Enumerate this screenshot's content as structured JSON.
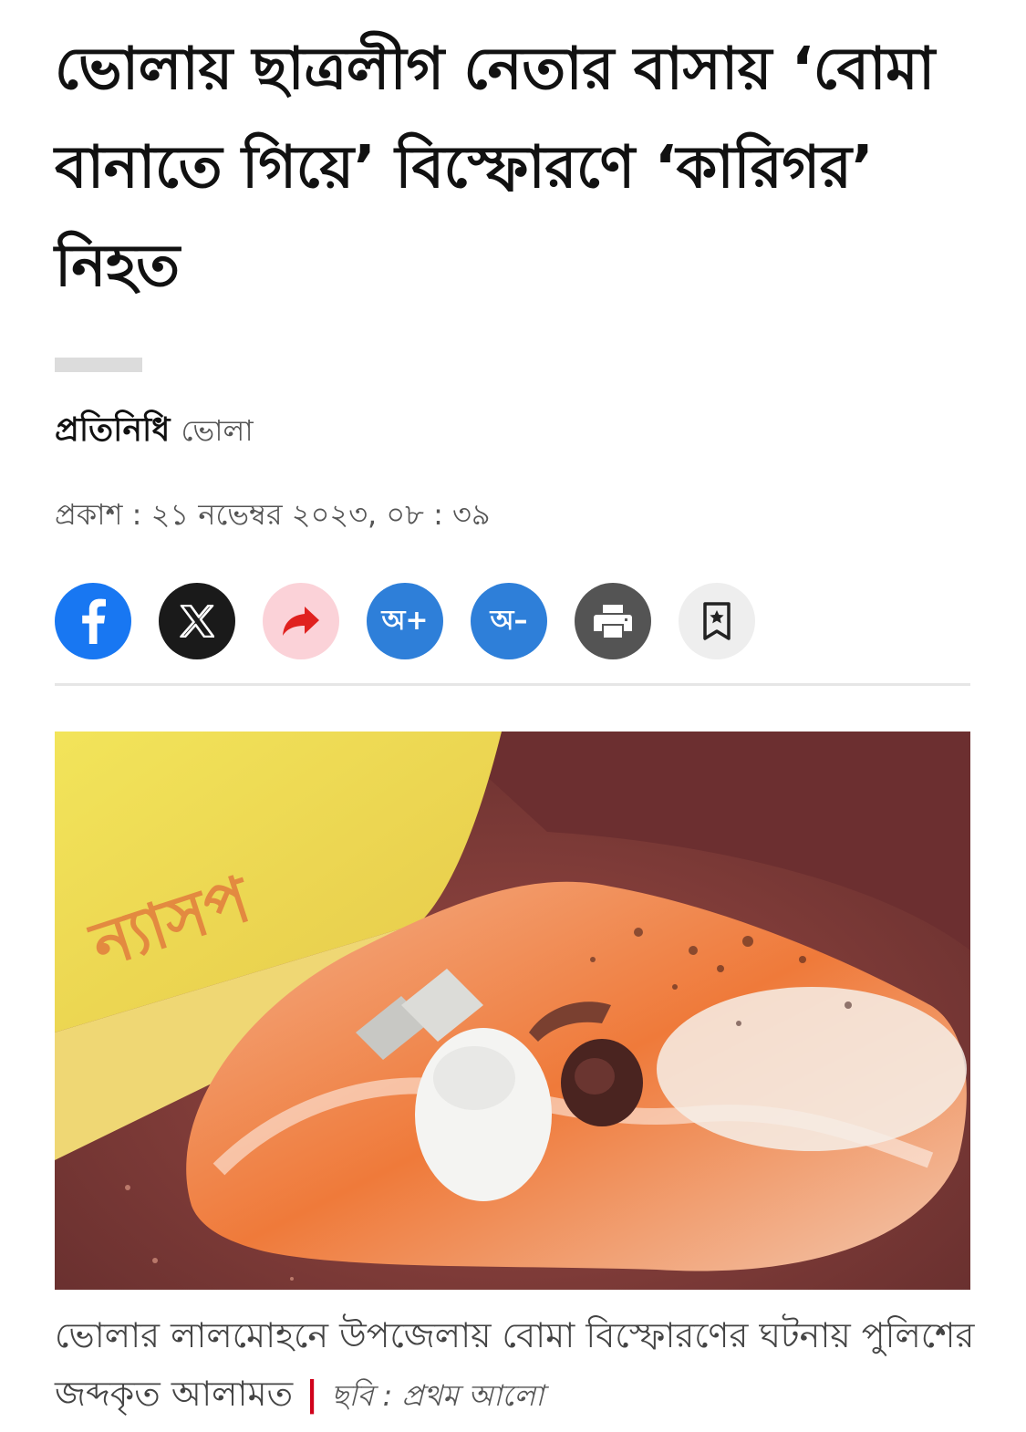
{
  "article": {
    "headline": "ভোলায় ছাত্রলীগ নেতার বাসায় ‘বোমা বানাতে গিয়ে’ বিস্ফোরণে ‘কারিগর’ নিহত",
    "byline": {
      "author": "প্রতিনিধি",
      "location": "ভোলা"
    },
    "published": "প্রকাশ : ২১ নভেম্বর ২০২৩, ০৮ : ৩৯",
    "photo": {
      "caption": "ভোলার লালমোহনে উপজেলায় বোমা বিস্ফোরণের ঘটনায় পুলিশের জব্দকৃত আলামত",
      "separator": "|",
      "credit": "ছবি : প্রথম আলো"
    }
  },
  "share": {
    "buttons": [
      {
        "id": "facebook",
        "icon": "facebook-icon",
        "color": "#1877f2"
      },
      {
        "id": "x",
        "icon": "x-icon",
        "color": "#1a1a1a"
      },
      {
        "id": "share",
        "icon": "share-arrow-icon",
        "color": "#fbd2d8"
      },
      {
        "id": "font-increase",
        "label": "অ+",
        "color": "#2e7fd9"
      },
      {
        "id": "font-decrease",
        "label": "অ–",
        "color": "#2e7fd9"
      },
      {
        "id": "print",
        "icon": "print-icon",
        "color": "#545454"
      },
      {
        "id": "bookmark",
        "icon": "bookmark-icon",
        "color": "#eeeeee"
      }
    ]
  }
}
